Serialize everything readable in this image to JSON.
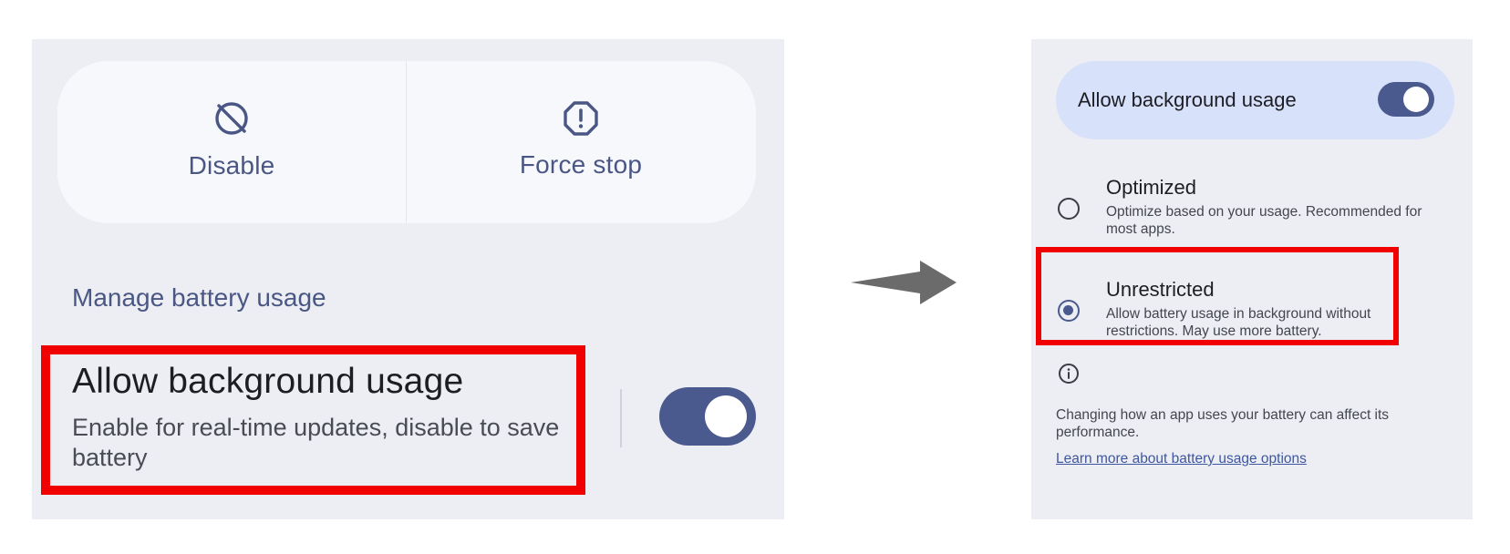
{
  "left": {
    "actions": {
      "disable_label": "Disable",
      "force_stop_label": "Force stop"
    },
    "section_title": "Manage battery usage",
    "background_usage": {
      "title": "Allow background usage",
      "description": "Enable for real-time updates, disable to save battery",
      "toggle_on": true
    }
  },
  "right": {
    "allow_background": {
      "label": "Allow background usage",
      "toggle_on": true
    },
    "options": [
      {
        "title": "Optimized",
        "description": "Optimize based on your usage. Recommended for most apps.",
        "selected": false
      },
      {
        "title": "Unrestricted",
        "description": "Allow battery usage in background without restrictions. May use more battery.",
        "selected": true
      }
    ],
    "note": "Changing how an app uses your battery can affect its performance.",
    "learn_more": "Learn more about battery usage options"
  },
  "colors": {
    "panel_bg": "#edeef3",
    "accent": "#4a5a8e",
    "highlight": "#f10000",
    "allow_card_bg": "#d8e1fa",
    "arrow": "#6b6b6b"
  }
}
